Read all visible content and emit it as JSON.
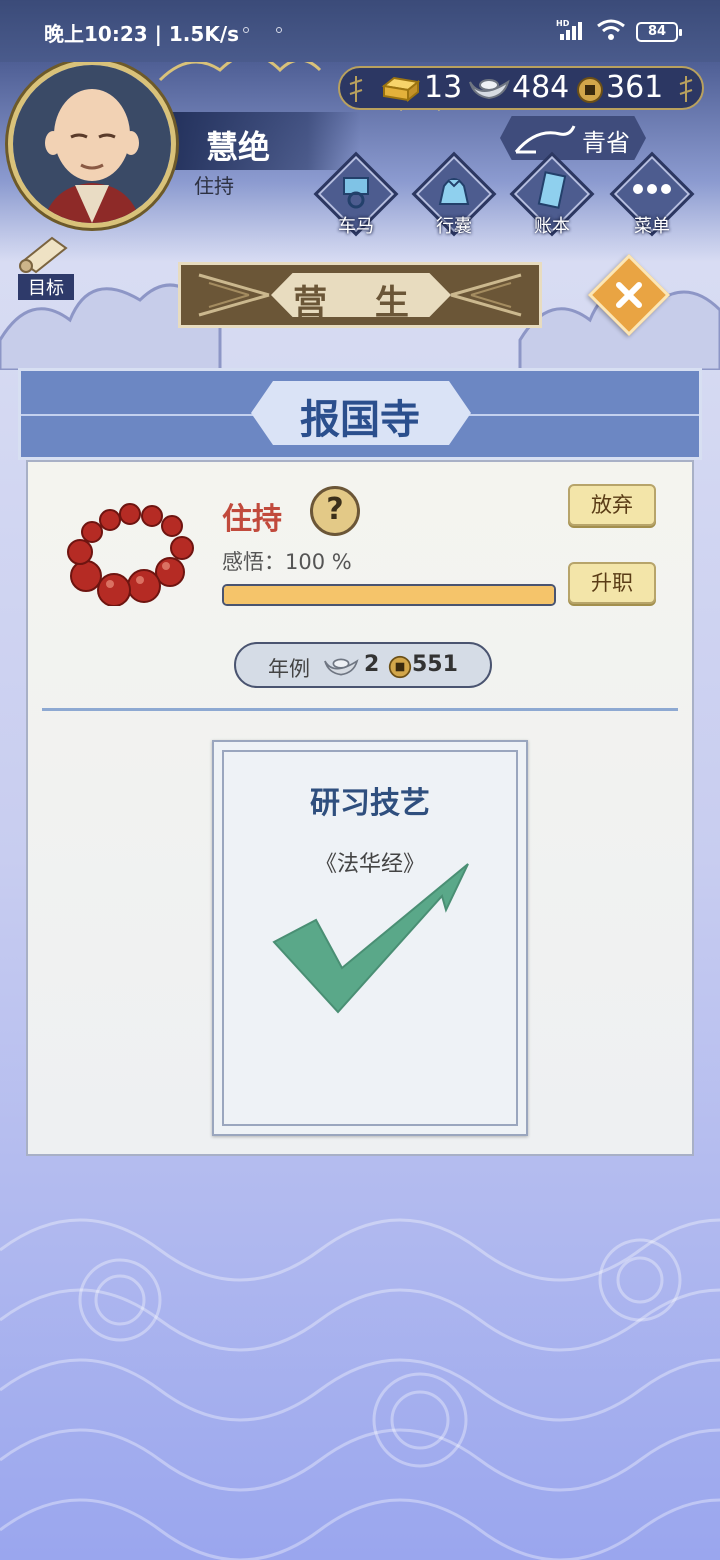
{
  "status_bar": {
    "time": "晚上10:23 | 1.5K/s",
    "signal_label": "HD",
    "battery": "84"
  },
  "player": {
    "name": "慧绝",
    "title": "住持"
  },
  "currency": {
    "gold": "13",
    "silver": "484",
    "copper": "361"
  },
  "rank": {
    "label": "青省"
  },
  "menu": [
    {
      "label": "车马",
      "icon": "carriage-icon"
    },
    {
      "label": "行囊",
      "icon": "bag-icon"
    },
    {
      "label": "账本",
      "icon": "ledger-icon"
    },
    {
      "label": "菜单",
      "icon": "more-icon"
    }
  ],
  "goal": {
    "label": "目标"
  },
  "section": {
    "title": "营 生"
  },
  "panel": {
    "place": "报国寺",
    "role": "住持",
    "help_label": "?",
    "insight": "感悟：100 %",
    "insight_progress": 1.0,
    "abandon_label": "放弃",
    "promote_label": "升职",
    "salary_label": "年例",
    "salary_silver": "2",
    "salary_copper": "551"
  },
  "card": {
    "title": "研习技艺",
    "subtitle": "《法华经》",
    "status_icon": "checkmark-icon"
  },
  "colors": {
    "header": "#3b4b79",
    "role_red": "#c14a3c",
    "place_blue": "#2b4f8d",
    "check_green": "#5aa889",
    "progress_fill": "#f5c46a"
  }
}
